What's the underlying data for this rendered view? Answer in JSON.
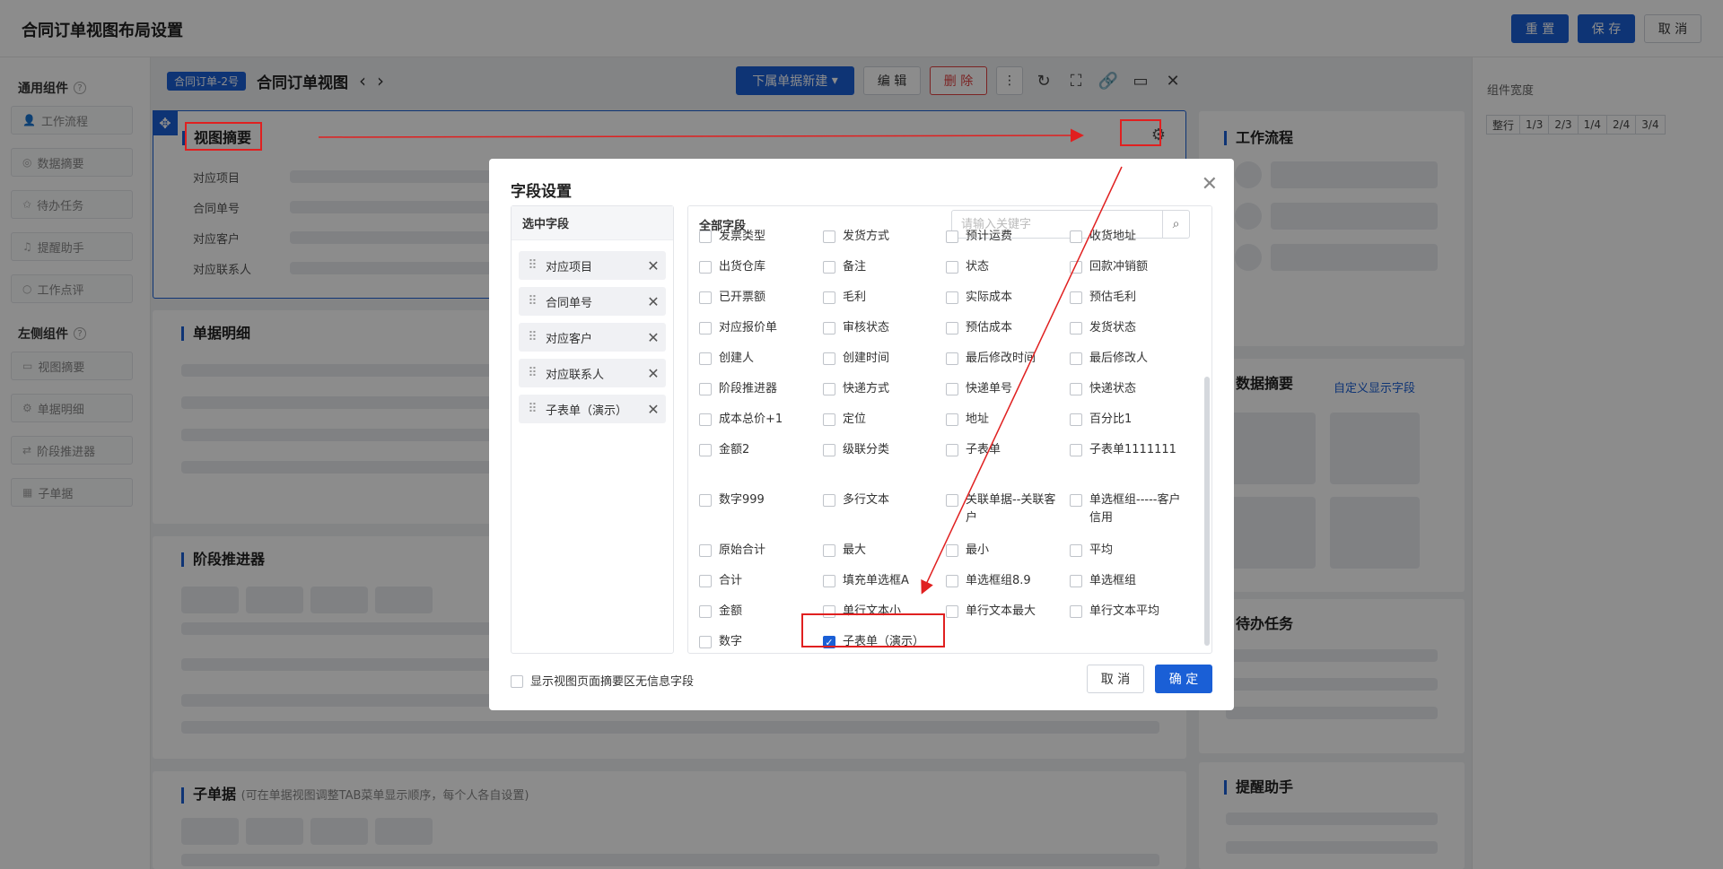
{
  "page": {
    "title": "合同订单视图布局设置"
  },
  "topbar": {
    "reset_label": "重 置",
    "save_label": "保 存",
    "cancel_label": "取 消"
  },
  "left_panel": {
    "section1": "通用组件",
    "section1_items": [
      "工作流程",
      "数据摘要",
      "待办任务",
      "提醒助手",
      "工作点评"
    ],
    "section2": "左侧组件",
    "section2_items": [
      "视图摘要",
      "单据明细",
      "阶段推进器",
      "子单据"
    ]
  },
  "view": {
    "tag": "合同订单-2号",
    "title": "合同订单视图",
    "sub_create": "下属单据新建",
    "edit": "编 辑",
    "delete": "删 除"
  },
  "summary_card": {
    "title": "视图摘要",
    "fields": [
      "对应项目",
      "合同单号",
      "对应客户",
      "对应联系人"
    ]
  },
  "detail_card": {
    "title": "单据明细"
  },
  "stage_card": {
    "title": "阶段推进器"
  },
  "sub_card": {
    "title": "子单据",
    "hint": "(可在单据视图调整TAB菜单显示顺序，每个人各自设置)"
  },
  "right_cards": {
    "workflow": "工作流程",
    "data_summary": "数据摘要",
    "custom_fields": "自定义显示字段",
    "todo": "待办任务",
    "reminder": "提醒助手"
  },
  "settings_panel": {
    "label": "组件宽度",
    "widths": [
      "整行",
      "1/3",
      "2/3",
      "1/4",
      "2/4",
      "3/4"
    ]
  },
  "modal": {
    "title": "字段设置",
    "selected_head": "选中字段",
    "all_head": "全部字段",
    "search_placeholder": "请输入关键字",
    "selected": [
      "对应项目",
      "合同单号",
      "对应客户",
      "对应联系人",
      "子表单（演示）"
    ],
    "all_fields": [
      [
        "发票类型",
        "发货方式",
        "预计运费",
        "收货地址"
      ],
      [
        "出货仓库",
        "备注",
        "状态",
        "回款冲销额"
      ],
      [
        "已开票额",
        "毛利",
        "实际成本",
        "预估毛利"
      ],
      [
        "对应报价单",
        "审核状态",
        "预估成本",
        "发货状态"
      ],
      [
        "创建人",
        "创建时间",
        "最后修改时间",
        "最后修改人"
      ],
      [
        "阶段推进器",
        "快递方式",
        "快递单号",
        "快递状态"
      ],
      [
        "成本总价+1",
        "定位",
        "地址",
        "百分比1"
      ],
      [
        "金额2",
        "级联分类",
        "子表单",
        "子表单1111111"
      ],
      [
        "数字999",
        "多行文本",
        "关联单据--关联客户",
        "单选框组-----客户信用"
      ],
      [
        "原始合计",
        "最大",
        "最小",
        "平均"
      ],
      [
        "合计",
        "填充单选框A",
        "单选框组8.9",
        "单选框组"
      ],
      [
        "金额",
        "单行文本小",
        "单行文本最大",
        "单行文本平均"
      ],
      [
        "数字",
        "子表单（演示）",
        "",
        ""
      ]
    ],
    "checked_field": "子表单（演示）",
    "footer_checkbox": "显示视图页面摘要区无信息字段",
    "cancel": "取 消",
    "confirm": "确 定"
  }
}
